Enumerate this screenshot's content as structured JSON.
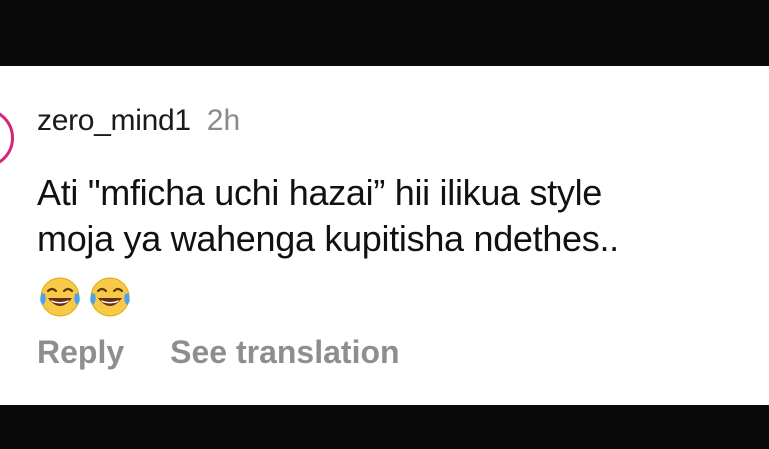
{
  "comment": {
    "username": "zero_mind1",
    "timestamp": "2h",
    "text_line1": "Ati \"mficha uchi hazai” hii ilikua style",
    "text_line2": "moja ya wahenga kupitisha ndethes..",
    "emojis": [
      "face-with-tears-of-joy-icon",
      "face-with-tears-of-joy-icon"
    ],
    "reply_label": "Reply",
    "translate_label": "See translation"
  },
  "colors": {
    "avatar_ring": "#d6257a",
    "muted_text": "#8e8e8e"
  }
}
